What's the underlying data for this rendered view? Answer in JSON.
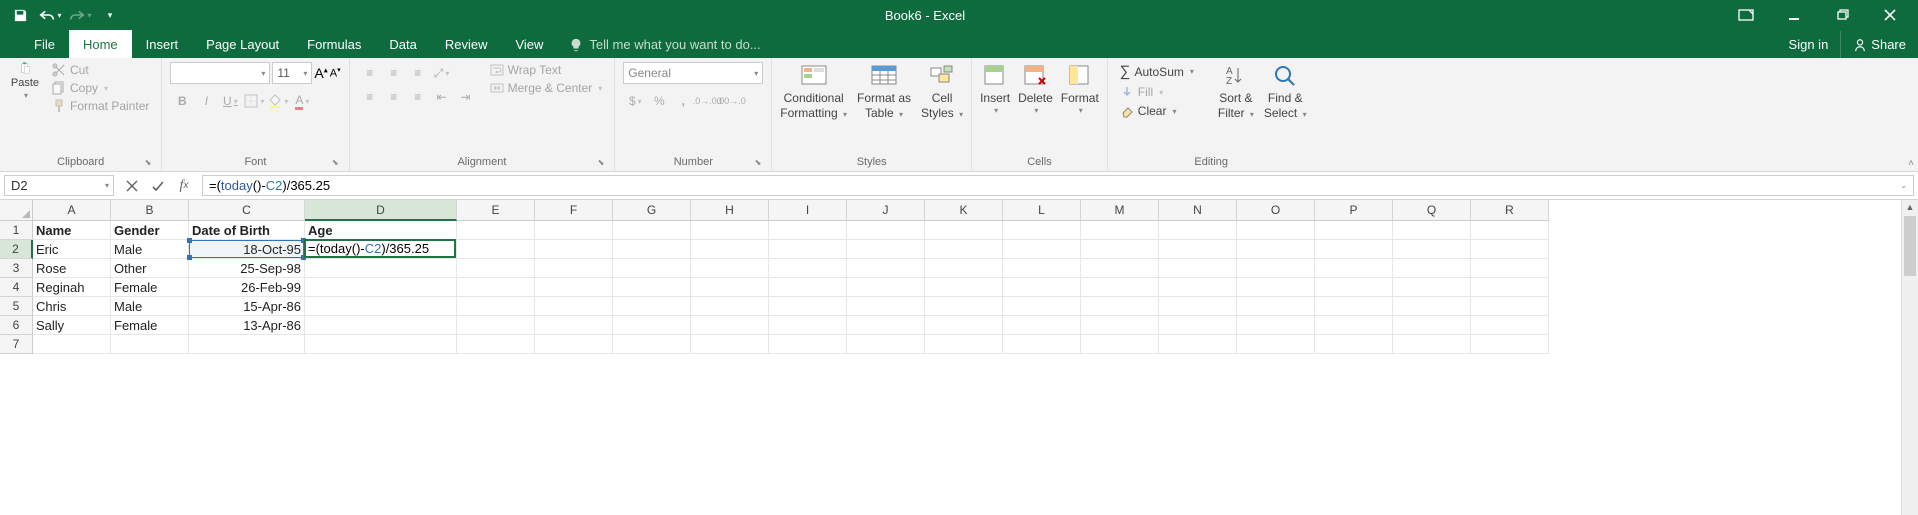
{
  "titlebar": {
    "title": "Book6 - Excel"
  },
  "tabs": {
    "file": "File",
    "home": "Home",
    "insert": "Insert",
    "pageLayout": "Page Layout",
    "formulas": "Formulas",
    "data": "Data",
    "review": "Review",
    "view": "View",
    "tellme": "Tell me what you want to do...",
    "signin": "Sign in",
    "share": "Share"
  },
  "ribbon": {
    "clipboard": {
      "label": "Clipboard",
      "paste": "Paste",
      "cut": "Cut",
      "copy": "Copy",
      "formatPainter": "Format Painter"
    },
    "font": {
      "label": "Font",
      "size": "11"
    },
    "alignment": {
      "label": "Alignment",
      "wrap": "Wrap Text",
      "merge": "Merge & Center"
    },
    "number": {
      "label": "Number",
      "format": "General"
    },
    "styles": {
      "label": "Styles",
      "conditional": "Conditional",
      "conditional2": "Formatting",
      "formatAs": "Format as",
      "formatAs2": "Table",
      "cellStyles": "Cell",
      "cellStyles2": "Styles"
    },
    "cells": {
      "label": "Cells",
      "insert": "Insert",
      "delete": "Delete",
      "format": "Format"
    },
    "editing": {
      "label": "Editing",
      "autosum": "AutoSum",
      "fill": "Fill",
      "clear": "Clear",
      "sortFilter": "Sort &",
      "sortFilter2": "Filter",
      "findSelect": "Find &",
      "findSelect2": "Select"
    }
  },
  "formulaBar": {
    "nameBox": "D2",
    "formula": "=(today()-C2)/365.25",
    "parts": {
      "eq": "=(",
      "fn": "today",
      "paren": "()",
      "minus": "-",
      "ref": "C2",
      "close": ")",
      "div": "/365.25"
    }
  },
  "grid": {
    "cols": [
      "A",
      "B",
      "C",
      "D",
      "E",
      "F",
      "G",
      "H",
      "I",
      "J",
      "K",
      "L",
      "M",
      "N",
      "O",
      "P",
      "Q",
      "R"
    ],
    "rowCount": 7,
    "headers": {
      "a": "Name",
      "b": "Gender",
      "c": "Date of Birth",
      "d": "Age"
    },
    "data": [
      {
        "a": "Eric",
        "b": "Male",
        "c": "18-Oct-95"
      },
      {
        "a": "Rose",
        "b": "Other",
        "c": "25-Sep-98"
      },
      {
        "a": "Reginah",
        "b": "Female",
        "c": "26-Feb-99"
      },
      {
        "a": "Chris",
        "b": "Male",
        "c": "15-Apr-86"
      },
      {
        "a": "Sally",
        "b": "Female",
        "c": "13-Apr-86"
      }
    ],
    "editing": {
      "row": 2,
      "col": "D",
      "display": "=(today()-C2)/365.25",
      "parts": {
        "pre": "=(",
        "fn": "today",
        "paren": "()-",
        "ref": "C2",
        "post": ")/365.25"
      }
    },
    "refHighlight": {
      "row": 2,
      "col": "C"
    }
  }
}
